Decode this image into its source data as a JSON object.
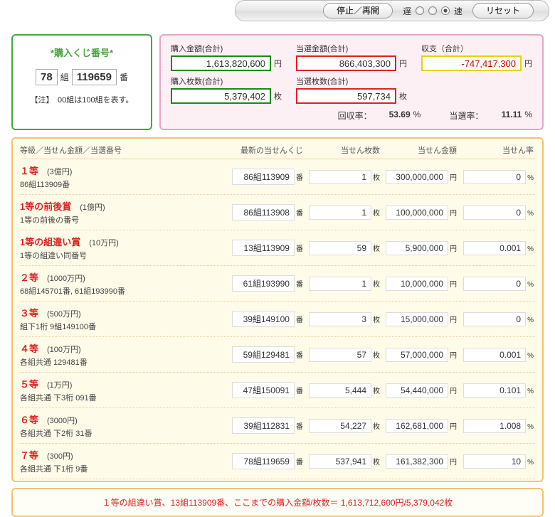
{
  "toolbar": {
    "pause": "停止／再開",
    "slow": "遅",
    "fast": "速",
    "reset": "リセット"
  },
  "ticket": {
    "title": "*購入くじ番号*",
    "kumi": "78",
    "kumi_lbl": "組",
    "num": "119659",
    "num_lbl": "番",
    "note": "【注】　00組は100組を表す。"
  },
  "stats": {
    "buy_amt_lbl": "購入金額(合計)",
    "buy_amt": "1,613,820,600",
    "yen": "円",
    "win_amt_lbl": "当選金額(合計)",
    "win_amt": "866,403,300",
    "bal_lbl": "収支（合計）",
    "bal": "-747,417,300",
    "buy_cnt_lbl": "購入枚数(合計)",
    "buy_cnt": "5,379,402",
    "mai": "枚",
    "win_cnt_lbl": "当選枚数(合計)",
    "win_cnt": "597,734",
    "recov_lbl": "回収率：",
    "recov": "53.69",
    "pct": "%",
    "hit_lbl": "当選率：",
    "hit": "11.11"
  },
  "headers": {
    "left": "等級／当せん金額／当選番号",
    "latest": "最新の当せんくじ",
    "count": "当せん枚数",
    "amount": "当せん金額",
    "rate": "当せん率"
  },
  "units": {
    "mai": "枚",
    "yen": "円",
    "pct": "%",
    "ban": "番"
  },
  "rows": [
    {
      "p": "１等",
      "a": "(3億円)",
      "s": "86組113909番",
      "latest": "86組113909",
      "cnt": "1",
      "amt": "300,000,000",
      "rate": "0"
    },
    {
      "p": "1等の前後賞",
      "a": "(1億円)",
      "s": "1等の前後の番号",
      "latest": "86組113908",
      "cnt": "1",
      "amt": "100,000,000",
      "rate": "0"
    },
    {
      "p": "1等の組違い賞",
      "a": "(10万円)",
      "s": "1等の組違い同番号",
      "latest": "13組113909",
      "cnt": "59",
      "amt": "5,900,000",
      "rate": "0.001"
    },
    {
      "p": "２等",
      "a": "(1000万円)",
      "s": "68組145701番, 61組193990番",
      "latest": "61組193990",
      "cnt": "1",
      "amt": "10,000,000",
      "rate": "0"
    },
    {
      "p": "３等",
      "a": "(500万円)",
      "s": "組下1桁 9組149100番",
      "latest": "39組149100",
      "cnt": "3",
      "amt": "15,000,000",
      "rate": "0"
    },
    {
      "p": "４等",
      "a": "(100万円)",
      "s": "各組共通 129481番",
      "latest": "59組129481",
      "cnt": "57",
      "amt": "57,000,000",
      "rate": "0.001"
    },
    {
      "p": "５等",
      "a": "(1万円)",
      "s": "各組共通 下3桁 091番",
      "latest": "47組150091",
      "cnt": "5,444",
      "amt": "54,440,000",
      "rate": "0.101"
    },
    {
      "p": "６等",
      "a": "(3000円)",
      "s": "各組共通 下2桁 31番",
      "latest": "39組112831",
      "cnt": "54,227",
      "amt": "162,681,000",
      "rate": "1.008"
    },
    {
      "p": "７等",
      "a": "(300円)",
      "s": "各組共通 下1桁 9番",
      "latest": "78組119659",
      "cnt": "537,941",
      "amt": "161,382,300",
      "rate": "10"
    }
  ],
  "eventbar": "１等の組違い賞、13組113909番、ここまでの購入金額/枚数＝ 1,613,712,600円/5,379,042枚"
}
